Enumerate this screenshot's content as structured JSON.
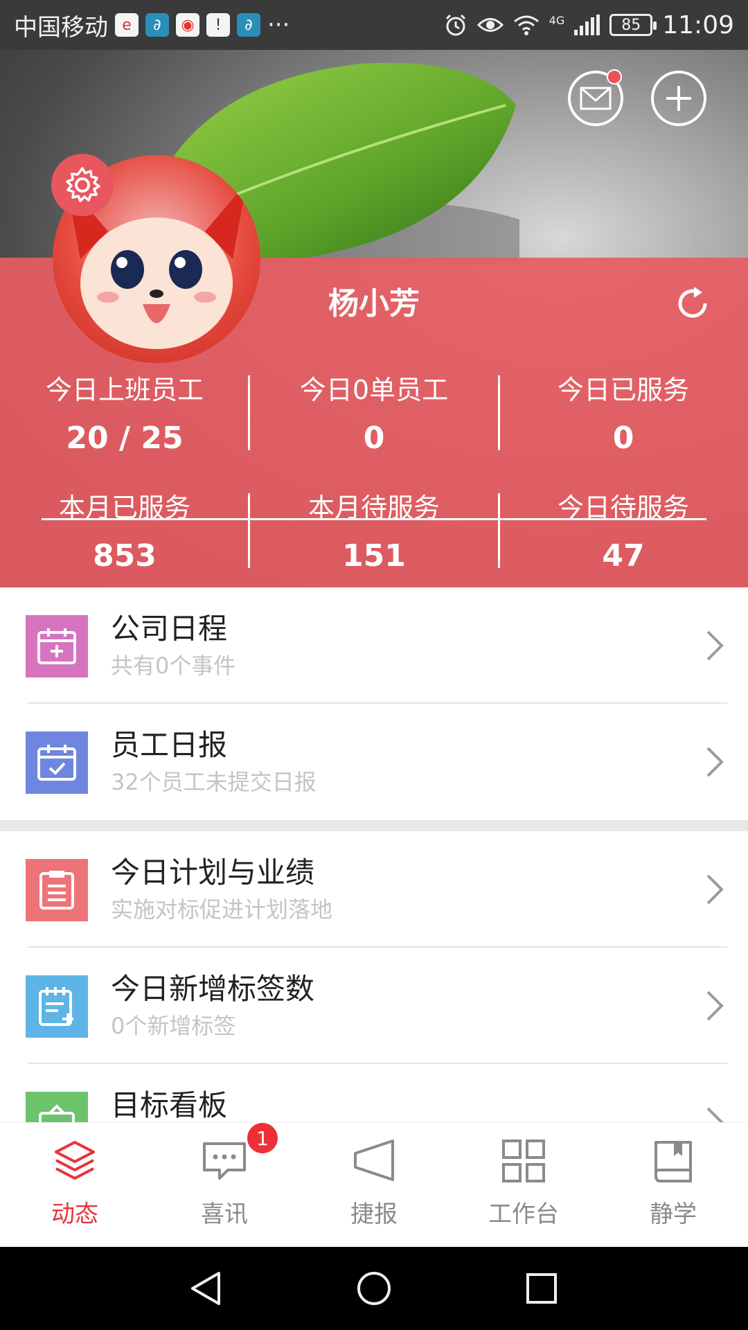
{
  "status_bar": {
    "carrier": "中国移动",
    "ellipsis": "···",
    "network": "4G",
    "battery": "85",
    "time": "11:09"
  },
  "header": {
    "user_name": "杨小芳"
  },
  "stats": [
    {
      "label": "今日上班员工",
      "value": "20 / 25"
    },
    {
      "label": "今日0单员工",
      "value": "0"
    },
    {
      "label": "今日已服务",
      "value": "0"
    },
    {
      "label": "本月已服务",
      "value": "853"
    },
    {
      "label": "本月待服务",
      "value": "151"
    },
    {
      "label": "今日待服务",
      "value": "47"
    }
  ],
  "list": [
    {
      "title": "公司日程",
      "subtitle": "共有0个事件",
      "icon": "calendar-plus-icon",
      "color": "#d774c0"
    },
    {
      "title": "员工日报",
      "subtitle": "32个员工未提交日报",
      "icon": "calendar-check-icon",
      "color": "#6e86e0"
    },
    {
      "title": "今日计划与业绩",
      "subtitle": "实施对标促进计划落地",
      "icon": "clipboard-icon",
      "color": "#ec7479"
    },
    {
      "title": "今日新增标签数",
      "subtitle": "0个新增标签",
      "icon": "tag-note-icon",
      "color": "#5eb4e6"
    },
    {
      "title": "目标看板",
      "subtitle": "",
      "icon": "target-board-icon",
      "color": "#6cc36c"
    }
  ],
  "bottom_nav": [
    {
      "label": "动态",
      "icon": "layers-icon",
      "active": true
    },
    {
      "label": "喜讯",
      "icon": "chat-bubble-icon",
      "badge": "1"
    },
    {
      "label": "捷报",
      "icon": "megaphone-icon"
    },
    {
      "label": "工作台",
      "icon": "grid-icon"
    },
    {
      "label": "静学",
      "icon": "book-icon"
    }
  ],
  "colors": {
    "accent": "#e7343b",
    "panel": "#e65c62",
    "muted": "#8a8a8a"
  }
}
